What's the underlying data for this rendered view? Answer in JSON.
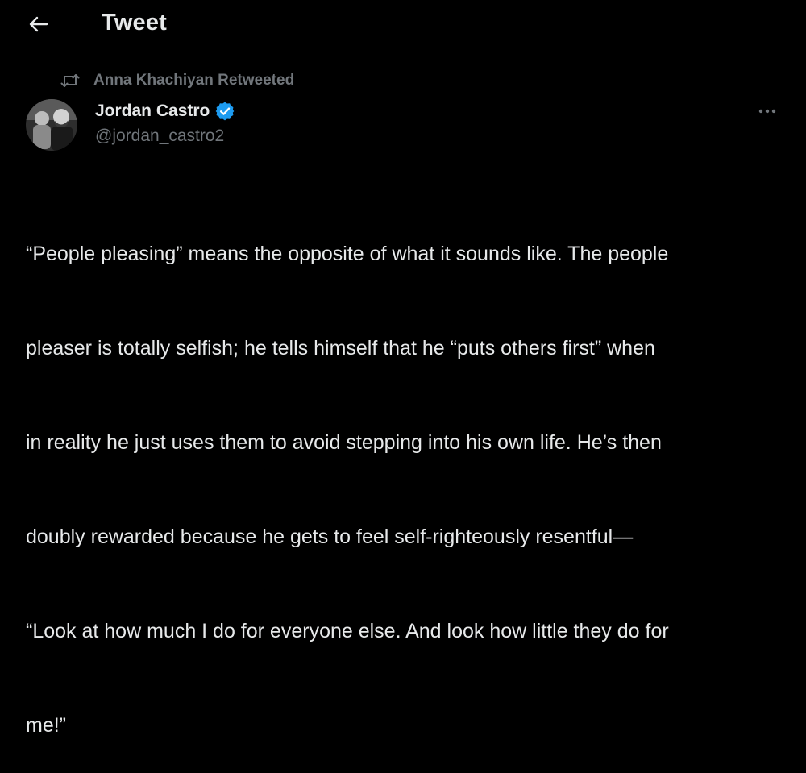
{
  "header": {
    "title": "Tweet"
  },
  "retweet": {
    "text": "Anna Khachiyan Retweeted"
  },
  "author": {
    "name": "Jordan Castro",
    "handle": "@jordan_castro2",
    "verified": true
  },
  "tweet": {
    "lines": [
      "“People pleasing” means the opposite of what it sounds like. The people",
      "pleaser is totally selfish; he tells himself that he “puts others first” when",
      "in reality he just uses them to avoid stepping into his own life. He’s then",
      "doubly rewarded because he gets to feel self-righteously resentful—",
      "“Look at how much I do for everyone else. And look how little they do for",
      "me!”"
    ]
  },
  "icons": {
    "back": "arrow-left-icon",
    "retweet": "retweet-icon",
    "verified": "verified-badge-icon",
    "more": "more-dots-icon"
  },
  "colors": {
    "background": "#000000",
    "text_primary": "#e7e9ea",
    "text_secondary": "#71767b",
    "verified": "#1d9bf0"
  }
}
